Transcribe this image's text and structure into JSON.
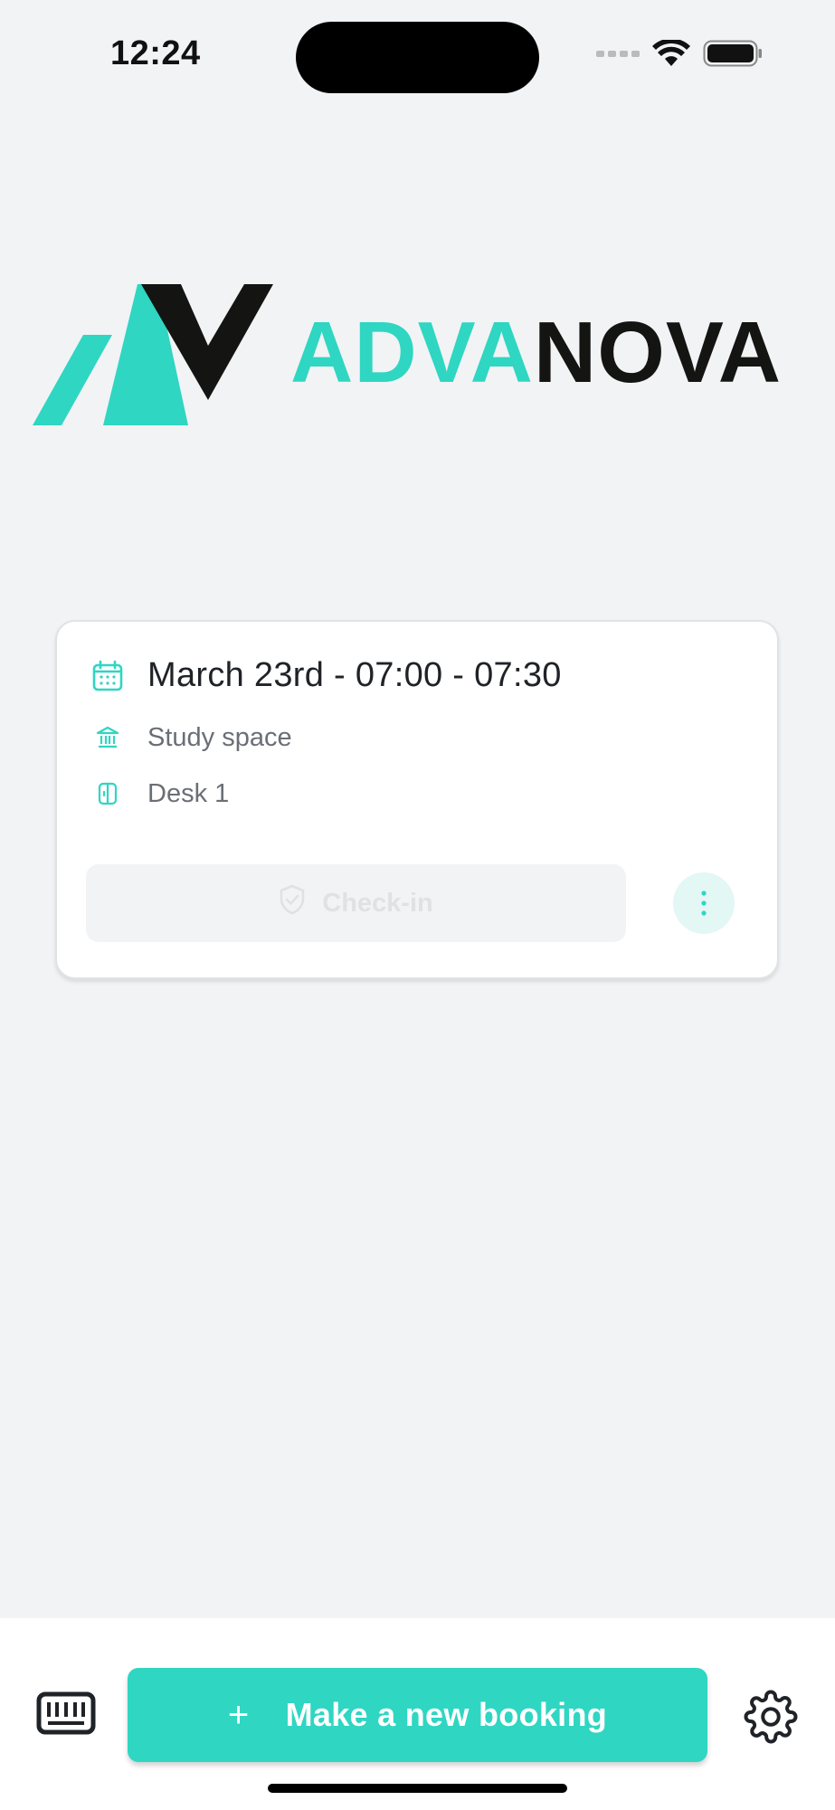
{
  "status_bar": {
    "time": "12:24"
  },
  "logo": {
    "text_accent": "ADVA",
    "text_dark": "NOVA",
    "accent_color": "#2fd6c2",
    "dark_color": "#141412"
  },
  "booking_card": {
    "date_time": "March 23rd - 07:00 - 07:30",
    "location": "Study space",
    "desk": "Desk 1",
    "checkin_label": "Check-in",
    "icons": {
      "date": "calendar-icon",
      "location": "building-icon",
      "desk": "desk-icon",
      "checkin": "shield-check-icon",
      "more": "more-vertical-icon"
    }
  },
  "bottom_bar": {
    "new_booking_plus": "+",
    "new_booking_label": "Make a new booking",
    "icons": {
      "left": "keyboard-icon",
      "right": "gear-icon"
    },
    "accent_color": "#2fd6c2"
  }
}
